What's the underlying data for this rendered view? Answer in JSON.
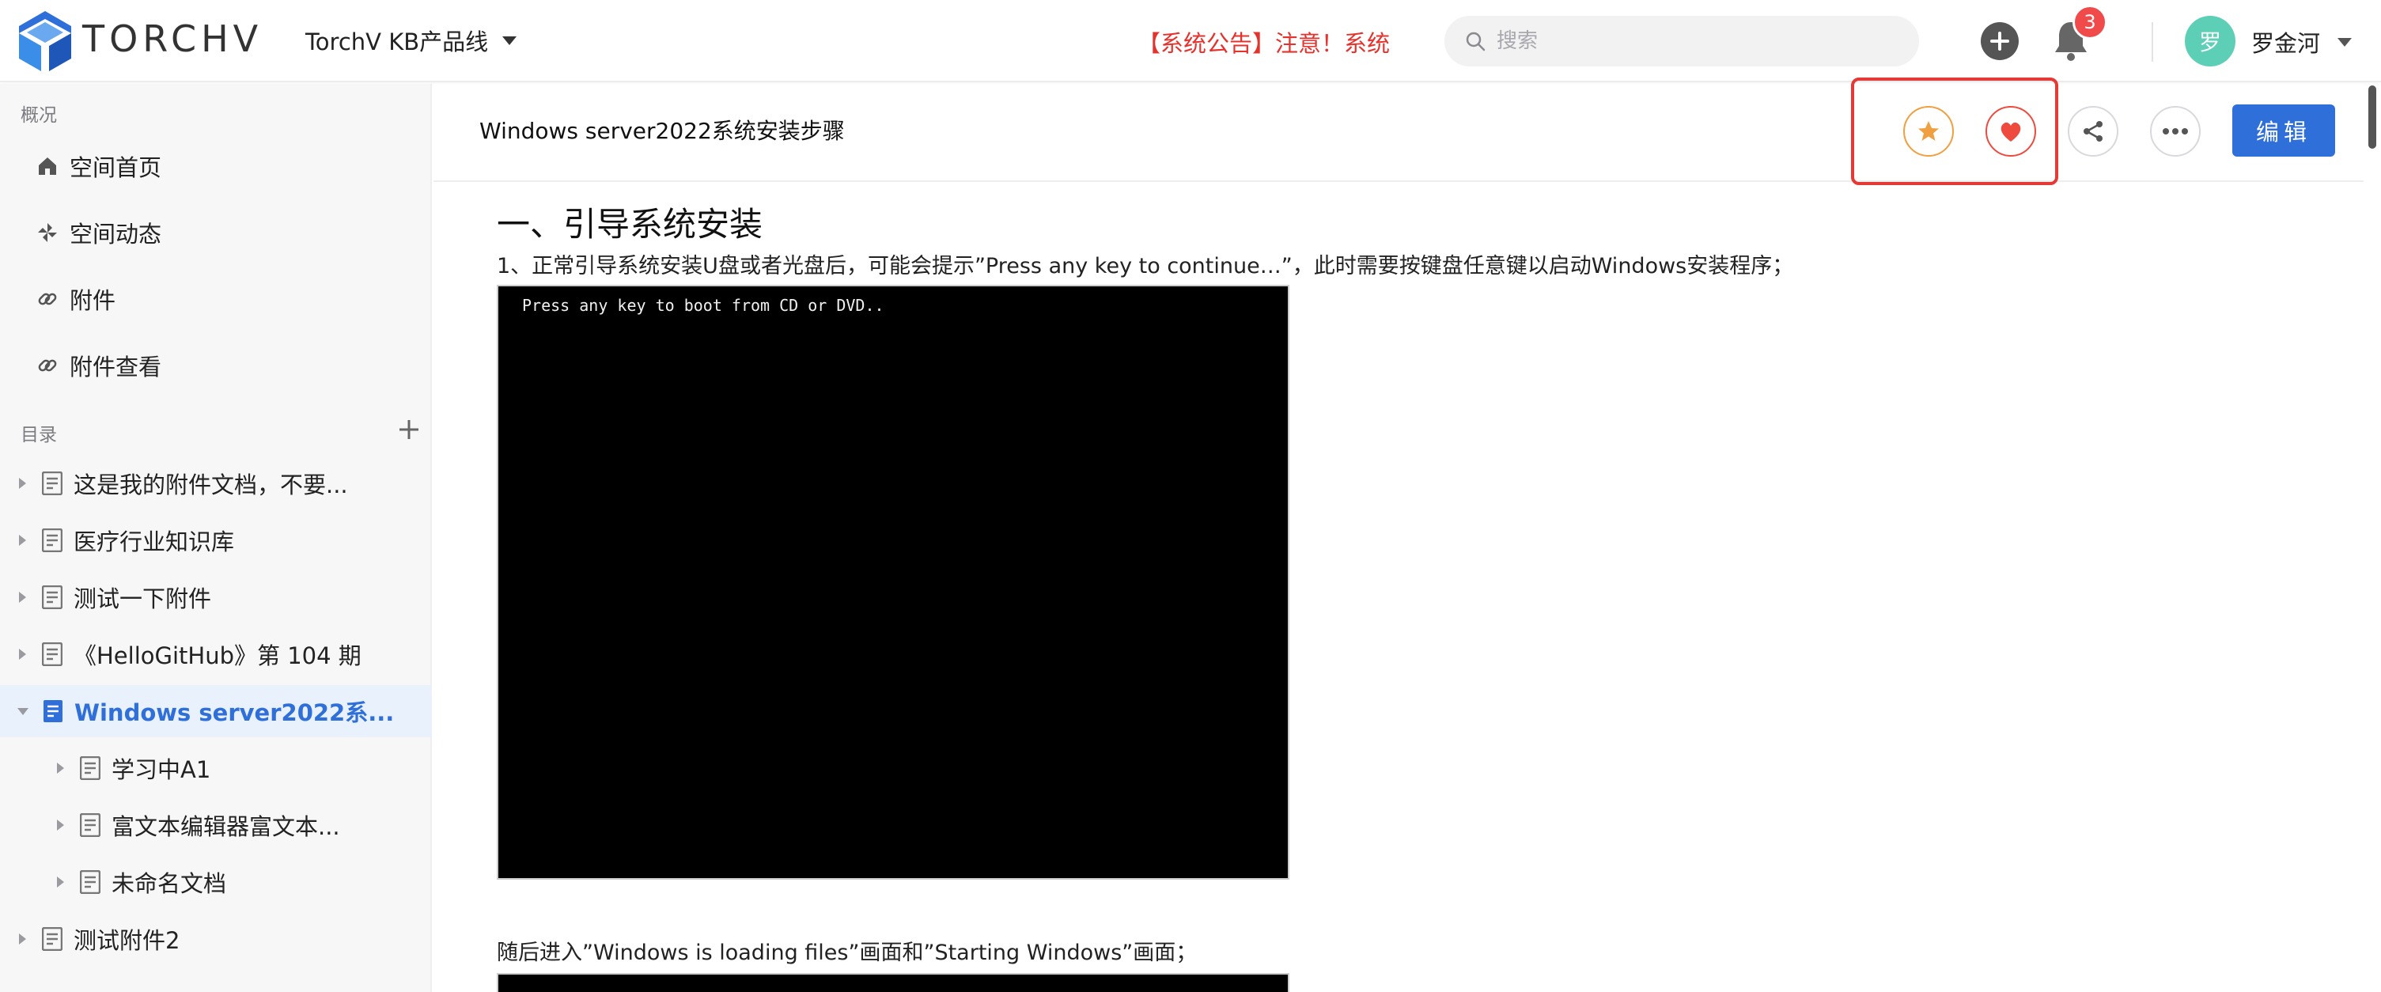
{
  "header": {
    "brand": "TORCHV",
    "product_line": "TorchV KB产品线",
    "announcement": "【系统公告】注意！系统",
    "search_placeholder": "搜索",
    "notification_count": "3",
    "user_avatar_text": "罗",
    "user_name": "罗金河"
  },
  "sidebar": {
    "overview_label": "概况",
    "nav": [
      {
        "label": "空间首页",
        "icon": "home-icon"
      },
      {
        "label": "空间动态",
        "icon": "pinwheel-icon"
      },
      {
        "label": "附件",
        "icon": "link-icon"
      },
      {
        "label": "附件查看",
        "icon": "link-icon"
      }
    ],
    "directory_label": "目录",
    "tree": [
      {
        "label": "这是我的附件文档，不要...",
        "level": 0,
        "expanded": false,
        "active": false
      },
      {
        "label": "医疗行业知识库",
        "level": 0,
        "expanded": false,
        "active": false
      },
      {
        "label": "测试一下附件",
        "level": 0,
        "expanded": false,
        "active": false
      },
      {
        "label": "《HelloGitHub》第 104 期",
        "level": 0,
        "expanded": false,
        "active": false
      },
      {
        "label": "Windows server2022系...",
        "level": 0,
        "expanded": true,
        "active": true
      },
      {
        "label": "学习中A1",
        "level": 1,
        "expanded": false,
        "active": false
      },
      {
        "label": "富文本编辑器富文本...",
        "level": 1,
        "expanded": false,
        "active": false
      },
      {
        "label": "未命名文档",
        "level": 1,
        "expanded": false,
        "active": false
      },
      {
        "label": "测试附件2",
        "level": 0,
        "expanded": false,
        "active": false
      }
    ]
  },
  "document": {
    "title": "Windows server2022系统安装步骤",
    "edit_label": "编辑",
    "heading": "一、引导系统安装",
    "para1": "1、正常引导系统安装U盘或者光盘后，可能会提示”Press any key to continue…”，此时需要按键盘任意键以启动Windows安装程序；",
    "screen_text": "Press any key to boot from CD or DVD..",
    "para2": "随后进入”Windows is loading files”画面和”Starting Windows”画面；"
  },
  "colors": {
    "accent": "#2f6fd9",
    "announcement": "#e5322d",
    "highlight": "#e53935",
    "star": "#f0a040",
    "heart": "#ef4a3e"
  }
}
